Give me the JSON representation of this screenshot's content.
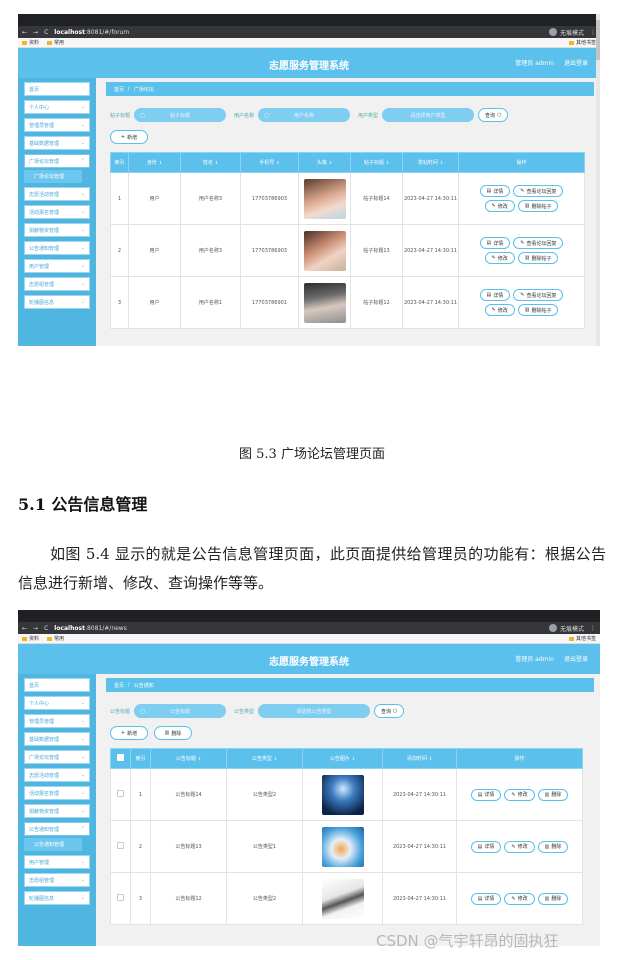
{
  "browser": {
    "url1_host": "localhost",
    "url1_rest": ":8081/#/forum",
    "url2_host": "localhost",
    "url2_rest": ":8081/#/news",
    "incognito": "无痕模式",
    "bookmarks": [
      "资料",
      "常用"
    ],
    "bookmarks_right": "其他书签"
  },
  "app": {
    "title": "志愿服务管理系统",
    "admin_label": "管理员 admin",
    "logout": "退出登录"
  },
  "sidebar1": [
    {
      "label": "首页"
    },
    {
      "label": "个人中心"
    },
    {
      "label": "管理员管理"
    },
    {
      "label": "基础数据管理"
    },
    {
      "label": "广场论坛管理"
    },
    {
      "label": "志愿活动管理"
    },
    {
      "label": "活动报名管理"
    },
    {
      "label": "捐献物资管理"
    },
    {
      "label": "公告通知管理"
    },
    {
      "label": "用户管理"
    },
    {
      "label": "志愿组管理"
    },
    {
      "label": "轮播图信息"
    }
  ],
  "sidebar1_sub": "广场论坛管理",
  "sidebar2": [
    {
      "label": "首页"
    },
    {
      "label": "个人中心"
    },
    {
      "label": "管理员管理"
    },
    {
      "label": "基础数据管理"
    },
    {
      "label": "广场论坛管理"
    },
    {
      "label": "志愿活动管理"
    },
    {
      "label": "活动报名管理"
    },
    {
      "label": "捐献物资管理"
    },
    {
      "label": "公告通知管理"
    },
    {
      "label": "用户管理"
    },
    {
      "label": "志愿组管理"
    },
    {
      "label": "轮播图信息"
    }
  ],
  "sidebar2_sub": "公告通知管理",
  "forum": {
    "crumb_home": "首页",
    "crumb_page": "广场论坛",
    "search": [
      {
        "label": "帖子标题",
        "placeholder": "帖子标题"
      },
      {
        "label": "用户名称",
        "placeholder": "用户名称"
      },
      {
        "label": "用户类型",
        "placeholder": "请选择用户类型"
      }
    ],
    "query": "查询",
    "add": "新增",
    "columns": [
      "索引",
      "身份",
      "姓名",
      "手机号",
      "头像",
      "帖子标题",
      "发帖时间",
      "操作"
    ],
    "rows": [
      {
        "idx": "1",
        "role": "用户",
        "name": "用户名称3",
        "phone": "17703786903",
        "title": "帖子标题14",
        "time": "2023-04-27 14:30:11"
      },
      {
        "idx": "2",
        "role": "用户",
        "name": "用户名称3",
        "phone": "17703786903",
        "title": "帖子标题13",
        "time": "2023-04-27 14:30:11"
      },
      {
        "idx": "3",
        "role": "用户",
        "name": "用户名称1",
        "phone": "17703786901",
        "title": "帖子标题12",
        "time": "2023-04-27 14:30:11"
      }
    ],
    "ops": [
      "详情",
      "查看论坛回复",
      "修改",
      "删除帖子"
    ]
  },
  "caption": "图 5.3  广场论坛管理页面",
  "heading": "5.1 公告信息管理",
  "paragraph": "如图 5.4 显示的就是公告信息管理页面，此页面提供给管理员的功能有：根据公告信息进行新增、修改、查询操作等等。",
  "news": {
    "crumb_home": "首页",
    "crumb_page": "公告通知",
    "search": [
      {
        "label": "公告标题",
        "placeholder": "公告标题"
      },
      {
        "label": "公告类型",
        "placeholder": "请选择公告类型"
      }
    ],
    "query": "查询",
    "add": "新增",
    "delete": "删除",
    "columns": [
      "索引",
      "公告标题",
      "公告类型",
      "公告图片",
      "添加时间",
      "操作"
    ],
    "rows": [
      {
        "idx": "1",
        "title": "公告标题14",
        "type": "公告类型2",
        "time": "2023-04-27 14:30:11"
      },
      {
        "idx": "2",
        "title": "公告标题13",
        "type": "公告类型1",
        "time": "2023-04-27 14:30:11"
      },
      {
        "idx": "3",
        "title": "公告标题12",
        "type": "公告类型2",
        "time": "2023-04-27 14:30:11"
      }
    ],
    "ops": [
      "详情",
      "修改",
      "删除"
    ]
  },
  "watermark": "CSDN @气宇轩昂的固执狂"
}
